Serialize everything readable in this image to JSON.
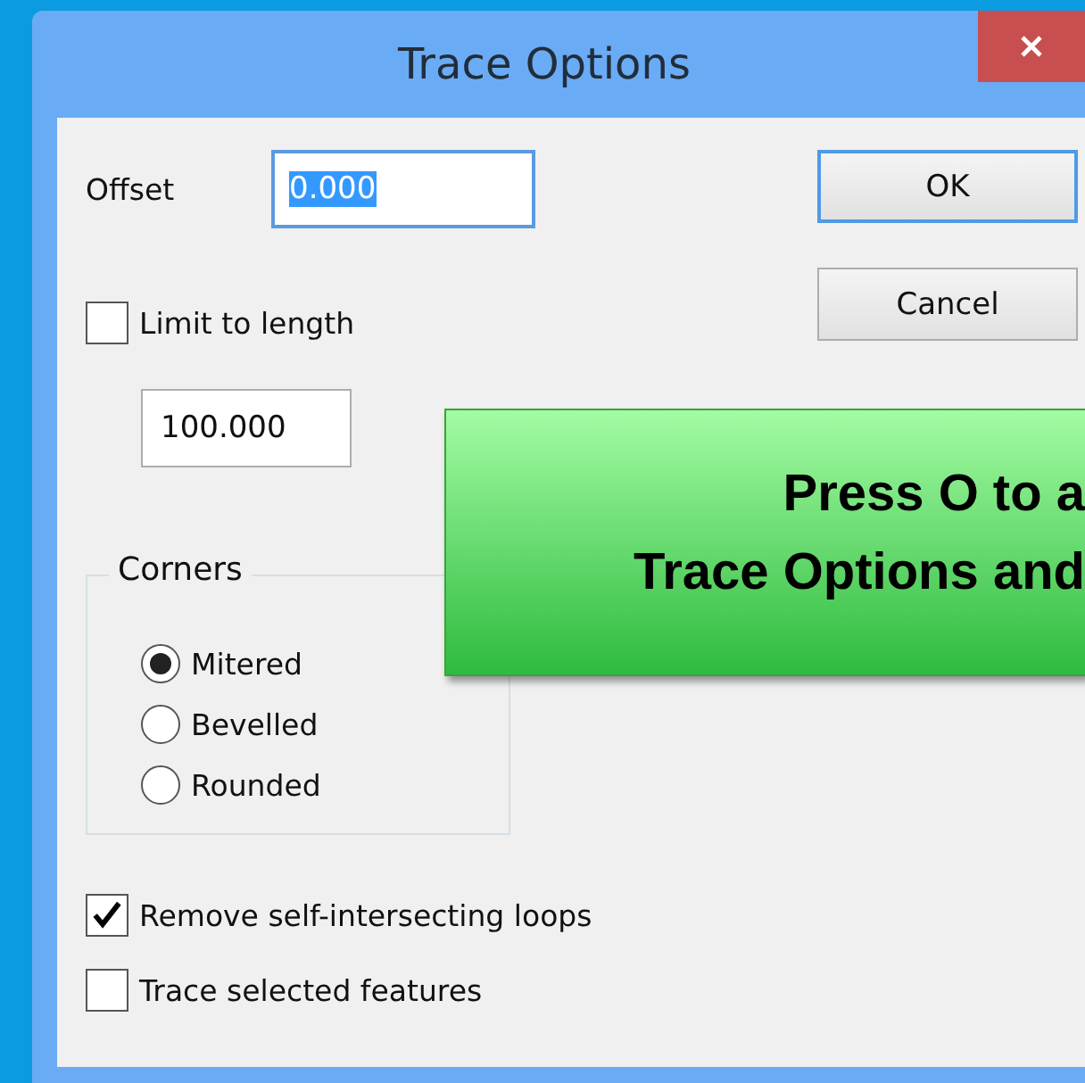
{
  "window": {
    "title": "Trace Options"
  },
  "offset": {
    "label": "Offset",
    "value": "0.000",
    "selected": true
  },
  "limit_to_length": {
    "label": "Limit to length",
    "checked": false,
    "value": "100.000"
  },
  "corners": {
    "title": "Corners",
    "options": [
      {
        "label": "Mitered",
        "selected": true
      },
      {
        "label": "Bevelled",
        "selected": false
      },
      {
        "label": "Rounded",
        "selected": false
      }
    ]
  },
  "options": [
    {
      "label": "Remove self-intersecting loops",
      "checked": true
    },
    {
      "label": "Trace selected features",
      "checked": false
    }
  ],
  "buttons": [
    {
      "label": "OK",
      "default": true
    },
    {
      "label": "Cancel",
      "default": false
    }
  ],
  "overlay": {
    "lines": [
      "Press O to a",
      "Trace Options and"
    ]
  }
}
